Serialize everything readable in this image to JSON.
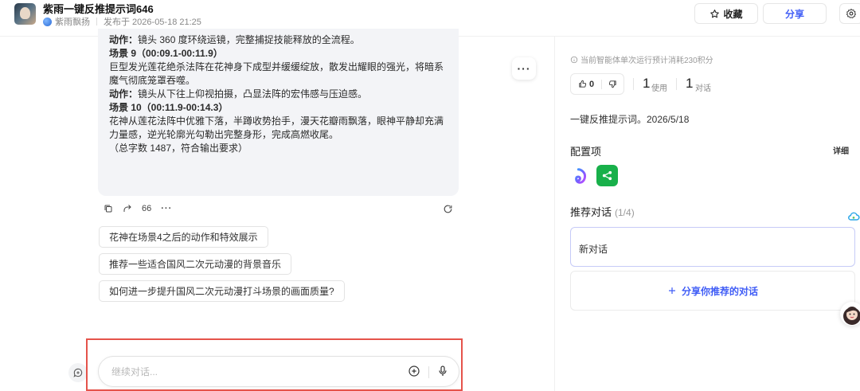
{
  "header": {
    "title": "紫雨一键反推提示词646",
    "author": "紫雨飘扬",
    "published": "发布于 2026-05-18 21:25",
    "collect_label": "收藏",
    "share_label": "分享"
  },
  "message": {
    "cut_line_label": "动作：",
    "cut_line_text": "镜头 360 度环绕运镜，完整捕捉技能释放的全流程。",
    "scene9_title": "场景 9（00:09.1-00:11.9）",
    "scene9_body": "巨型发光莲花绝杀法阵在花神身下成型并缓缓绽放，散发出耀眼的强光，将暗系魔气彻底笼罩吞噬。",
    "scene9_action_label": "动作：",
    "scene9_action": "镜头从下往上仰视拍摄，凸显法阵的宏伟感与压迫感。",
    "scene10_title": "场景 10（00:11.9-00:14.3）",
    "scene10_body": "花神从莲花法阵中优雅下落，半蹲收势抬手，漫天花瓣雨飘落，眼神平静却充满力量感，逆光轮廓光勾勒出完整身形，完成高燃收尾。",
    "footer_note": "（总字数 1487，符合输出要求）"
  },
  "actions": {
    "count": "66"
  },
  "suggestions": [
    "花神在场景4之后的动作和特效展示",
    "推荐一些适合国风二次元动漫的背景音乐",
    "如何进一步提升国风二次元动漫打斗场景的画面质量?"
  ],
  "input": {
    "placeholder": "继续对话..."
  },
  "panel": {
    "cost_note": "当前智能体单次运行预计消耗230积分",
    "likes": "0",
    "uses_count": "1",
    "uses_label": "使用",
    "chats_count": "1",
    "chats_label": "对话",
    "description": "一键反推提示词。2026/5/18",
    "config_title": "配置项",
    "detail_label": "详细",
    "recommend_title": "推荐对话",
    "recommend_count": "(1/4)",
    "new_chat_label": "新对话",
    "share_recommend_label": "分享你推荐的对话"
  }
}
